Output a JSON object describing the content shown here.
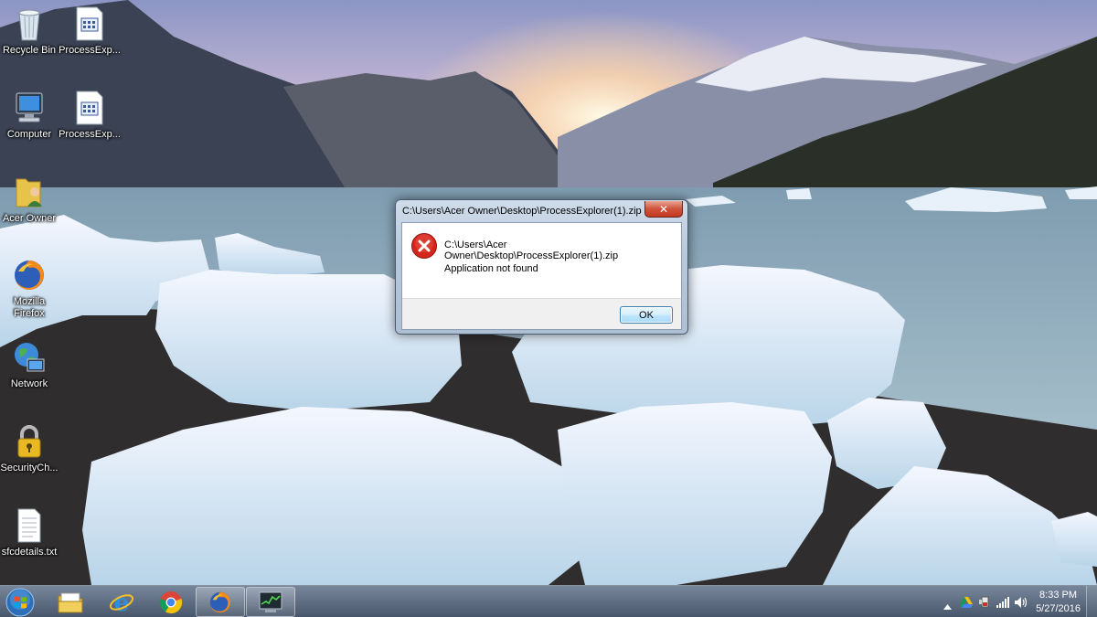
{
  "desktop": {
    "icons": [
      {
        "label": "Recycle Bin",
        "icon": "recycle-bin-icon"
      },
      {
        "label": "ProcessExp...",
        "icon": "document-icon"
      },
      {
        "label": "Computer",
        "icon": "computer-icon"
      },
      {
        "label": "ProcessExp...",
        "icon": "document-icon"
      },
      {
        "label": "Acer Owner",
        "icon": "user-folder-icon"
      },
      {
        "label": "Mozilla\nFirefox",
        "icon": "firefox-icon"
      },
      {
        "label": "Network",
        "icon": "network-icon"
      },
      {
        "label": "SecurityCh...",
        "icon": "security-lock-icon"
      },
      {
        "label": "sfcdetails.txt",
        "icon": "text-file-icon"
      }
    ]
  },
  "dialog": {
    "title": "C:\\Users\\Acer Owner\\Desktop\\ProcessExplorer(1).zip",
    "close_label": "✕",
    "message_path": "C:\\Users\\Acer Owner\\Desktop\\ProcessExplorer(1).zip",
    "message_text": "Application not found",
    "ok_label": "OK",
    "icon": "error-icon"
  },
  "taskbar": {
    "start": "windows-start-icon",
    "pinned": [
      {
        "name": "file-explorer-icon"
      },
      {
        "name": "internet-explorer-icon"
      },
      {
        "name": "chrome-icon"
      },
      {
        "name": "firefox-icon",
        "active": true
      },
      {
        "name": "task-manager-icon",
        "active": true
      }
    ],
    "tray": {
      "icons": [
        "show-hidden-icons-icon",
        "google-drive-icon",
        "power-icon",
        "network-signal-icon",
        "volume-icon"
      ],
      "time": "8:33 PM",
      "date": "5/27/2016"
    }
  },
  "colors": {
    "accent_close": "#c2391f",
    "ok_border": "#3c7fb1",
    "error_red": "#d4261c"
  }
}
